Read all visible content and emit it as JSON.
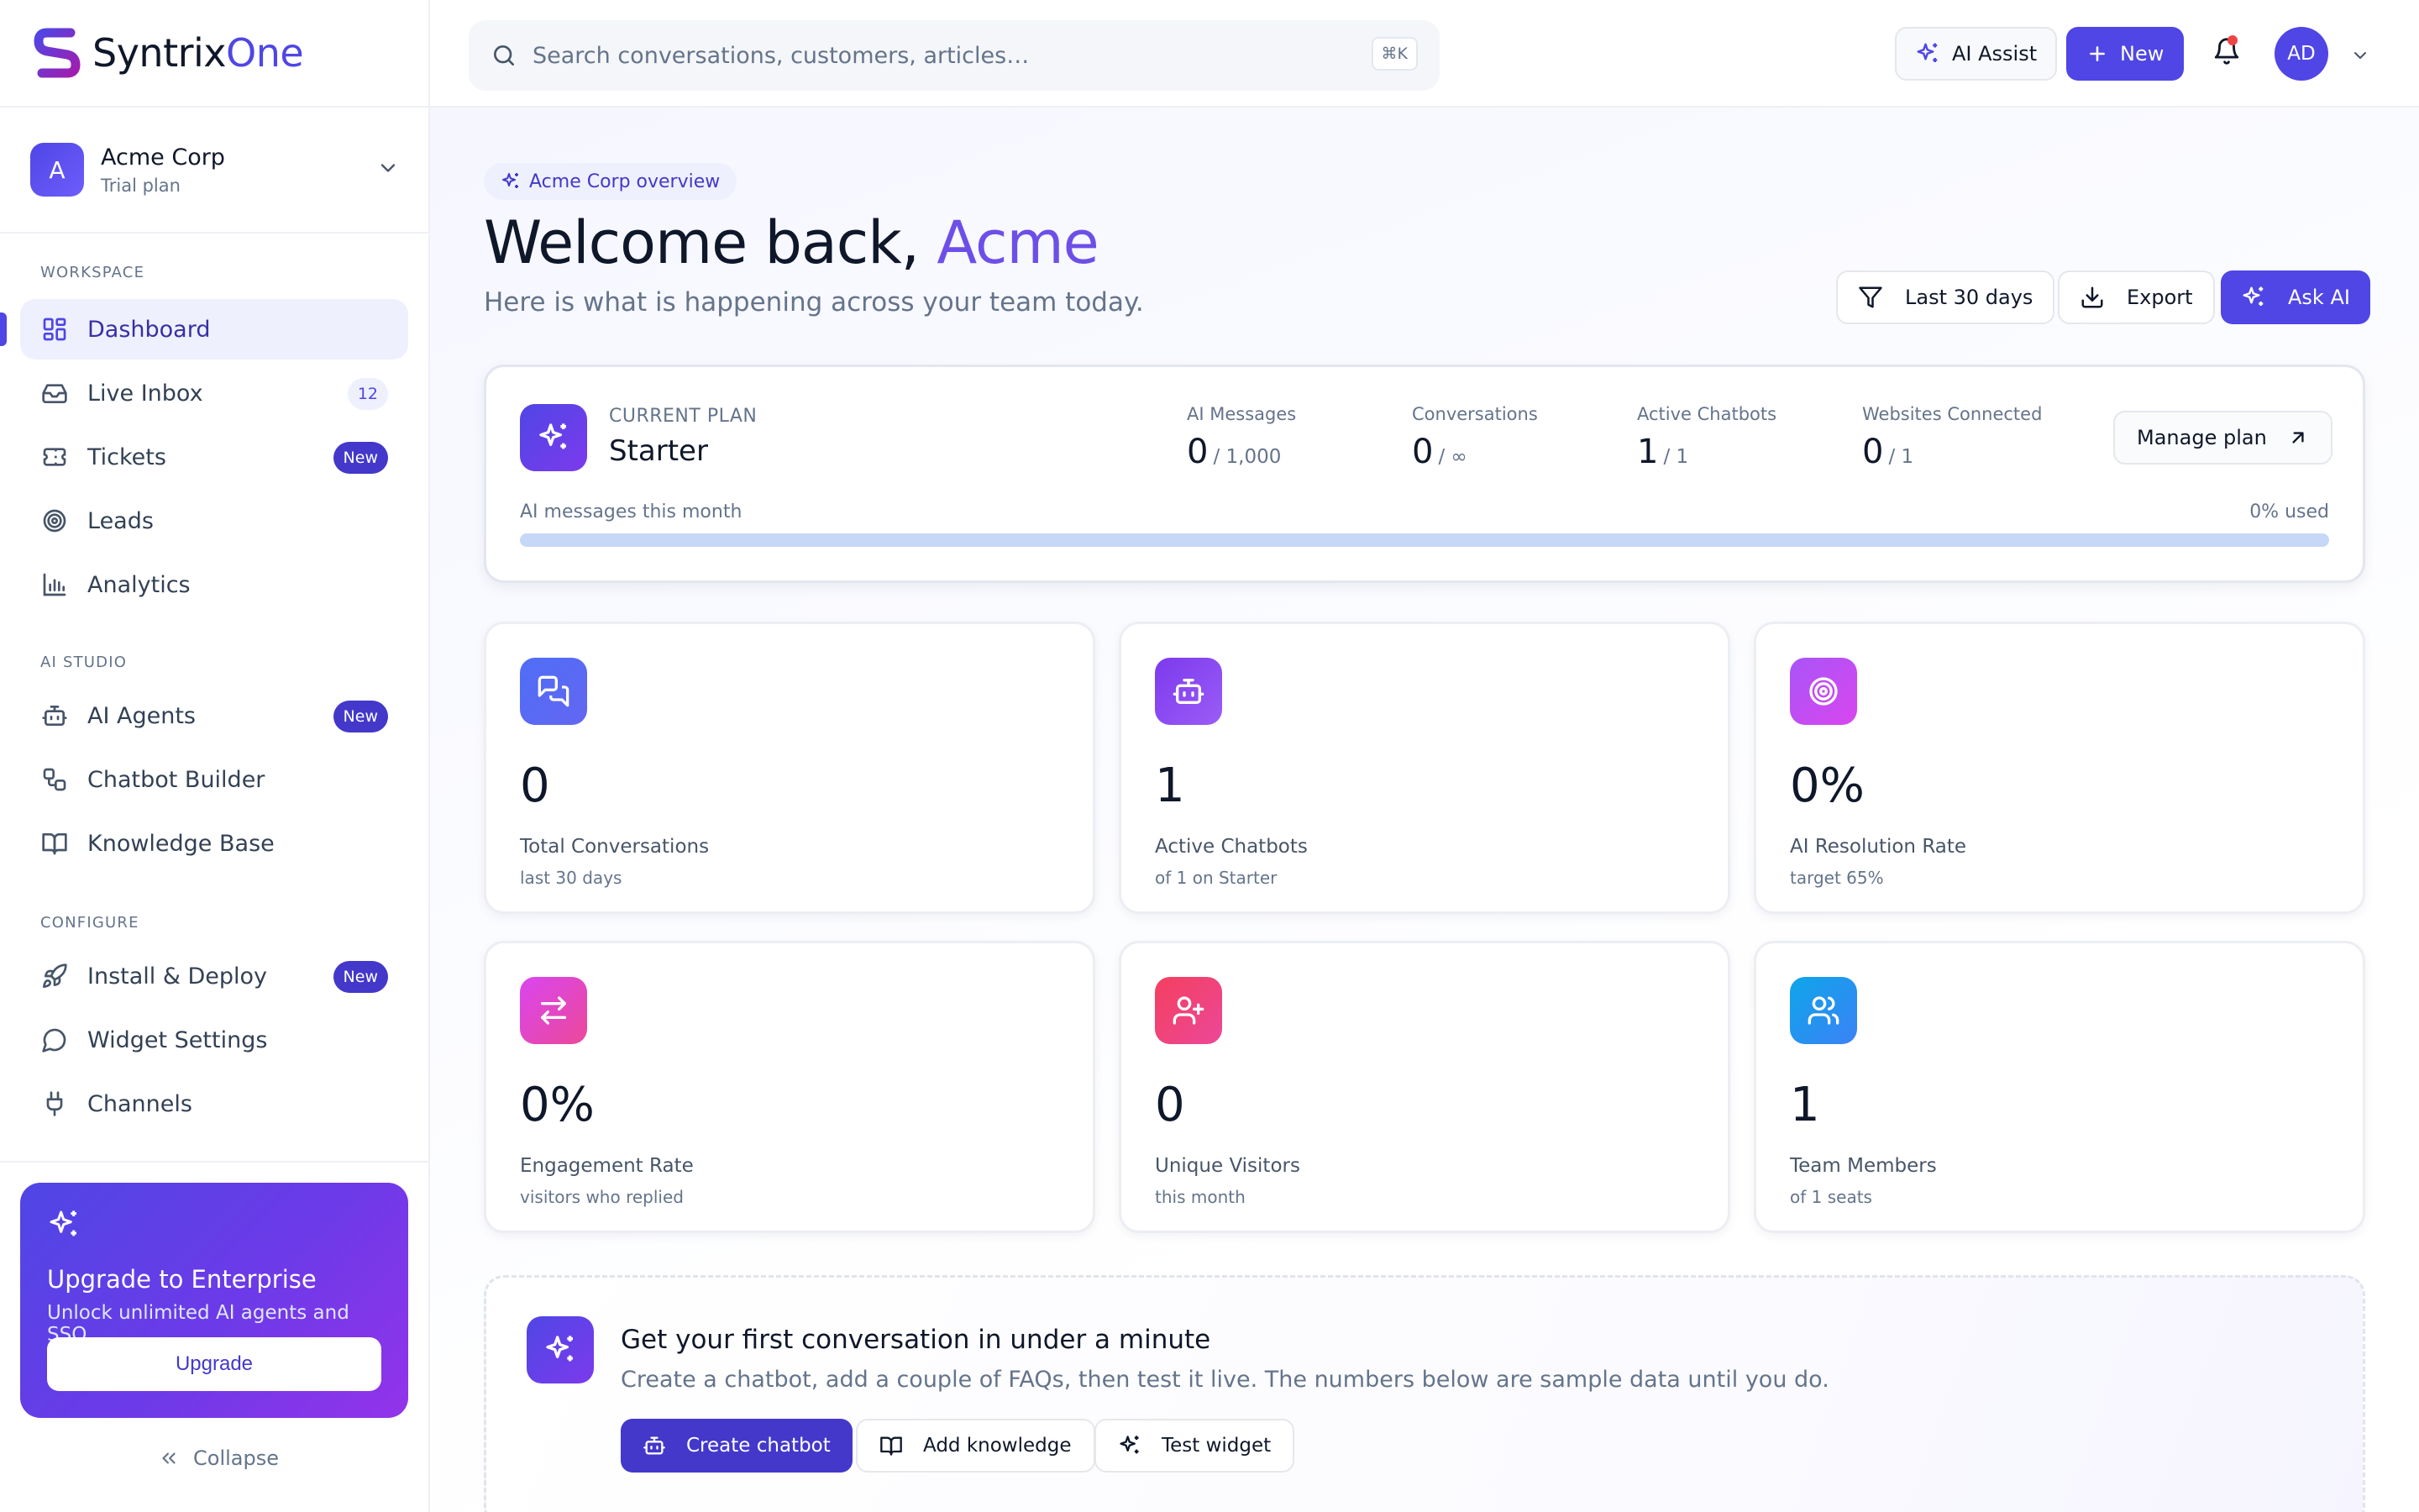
{
  "brand": {
    "name_main": "Syntrix",
    "name_accent": "One"
  },
  "workspace": {
    "avatar_letter": "A",
    "name": "Acme Corp",
    "plan": "Trial plan"
  },
  "sidebar": {
    "sections": [
      {
        "label": "WORKSPACE"
      },
      {
        "label": "AI STUDIO"
      },
      {
        "label": "CONFIGURE"
      }
    ],
    "items": [
      {
        "label": "Dashboard",
        "icon": "layout-grid-icon",
        "active": true
      },
      {
        "label": "Live Inbox",
        "icon": "inbox-icon",
        "badge": "12"
      },
      {
        "label": "Tickets",
        "icon": "ticket-icon",
        "badge": "New"
      },
      {
        "label": "Leads",
        "icon": "target-icon"
      },
      {
        "label": "Analytics",
        "icon": "bar-chart-icon"
      },
      {
        "label": "AI Agents",
        "icon": "bot-icon",
        "badge": "New"
      },
      {
        "label": "Chatbot Builder",
        "icon": "workflow-icon"
      },
      {
        "label": "Knowledge Base",
        "icon": "book-icon"
      },
      {
        "label": "Install & Deploy",
        "icon": "rocket-icon",
        "badge": "New"
      },
      {
        "label": "Widget Settings",
        "icon": "message-circle-icon"
      },
      {
        "label": "Channels",
        "icon": "plug-icon"
      }
    ],
    "upgrade": {
      "title": "Upgrade to Enterprise",
      "subtitle": "Unlock unlimited AI agents and SSO.",
      "button": "Upgrade"
    },
    "collapse_label": "Collapse"
  },
  "topbar": {
    "search_placeholder": "Search conversations, customers, articles…",
    "search_shortcut": "⌘K",
    "ai_assist_label": "AI Assist",
    "new_label": "New",
    "user_initials": "AD",
    "has_notification": true
  },
  "header": {
    "pill": "Acme Corp overview",
    "welcome_prefix": "Welcome back, ",
    "welcome_name": "Acme",
    "subtitle": "Here is what is happening across your team today.",
    "range_label": "Last 30 days",
    "export_label": "Export",
    "ask_ai_label": "Ask AI"
  },
  "plan": {
    "label": "CURRENT PLAN",
    "name": "Starter",
    "stats": [
      {
        "label": "AI Messages",
        "value": "0",
        "limit": "/ 1,000"
      },
      {
        "label": "Conversations",
        "value": "0",
        "limit": "/ ∞"
      },
      {
        "label": "Active Chatbots",
        "value": "1",
        "limit": "/ 1"
      },
      {
        "label": "Websites Connected",
        "value": "0",
        "limit": "/ 1"
      }
    ],
    "manage_label": "Manage plan",
    "usage_label": "AI messages this month",
    "usage_text": "0% used",
    "usage_fraction": 0
  },
  "stats": [
    {
      "value": "0",
      "label": "Total Conversations",
      "sub": "last 30 days",
      "icon": "messages-icon",
      "color_from": "#4f6ef7",
      "color_to": "#6366f1"
    },
    {
      "value": "1",
      "label": "Active Chatbots",
      "sub": "of 1 on Starter",
      "icon": "bot-icon",
      "color_from": "#7c3aed",
      "color_to": "#9b5cf6"
    },
    {
      "value": "0%",
      "label": "AI Resolution Rate",
      "sub": "target 65%",
      "icon": "target-icon",
      "color_from": "#a855f7",
      "color_to": "#d946ef"
    },
    {
      "value": "0%",
      "label": "Engagement Rate",
      "sub": "visitors who replied",
      "icon": "arrows-swap-icon",
      "color_from": "#d946ef",
      "color_to": "#ec4899"
    },
    {
      "value": "0",
      "label": "Unique Visitors",
      "sub": "this month",
      "icon": "user-plus-icon",
      "color_from": "#f43f5e",
      "color_to": "#ec4899"
    },
    {
      "value": "1",
      "label": "Team Members",
      "sub": "of 1 seats",
      "icon": "users-icon",
      "color_from": "#0ea5e9",
      "color_to": "#3b82f6"
    }
  ],
  "onboarding": {
    "title": "Get your first conversation in under a minute",
    "subtitle": "Create a chatbot, add a couple of FAQs, then test it live. The numbers below are sample data until you do.",
    "create_label": "Create chatbot",
    "knowledge_label": "Add knowledge",
    "test_label": "Test widget"
  }
}
